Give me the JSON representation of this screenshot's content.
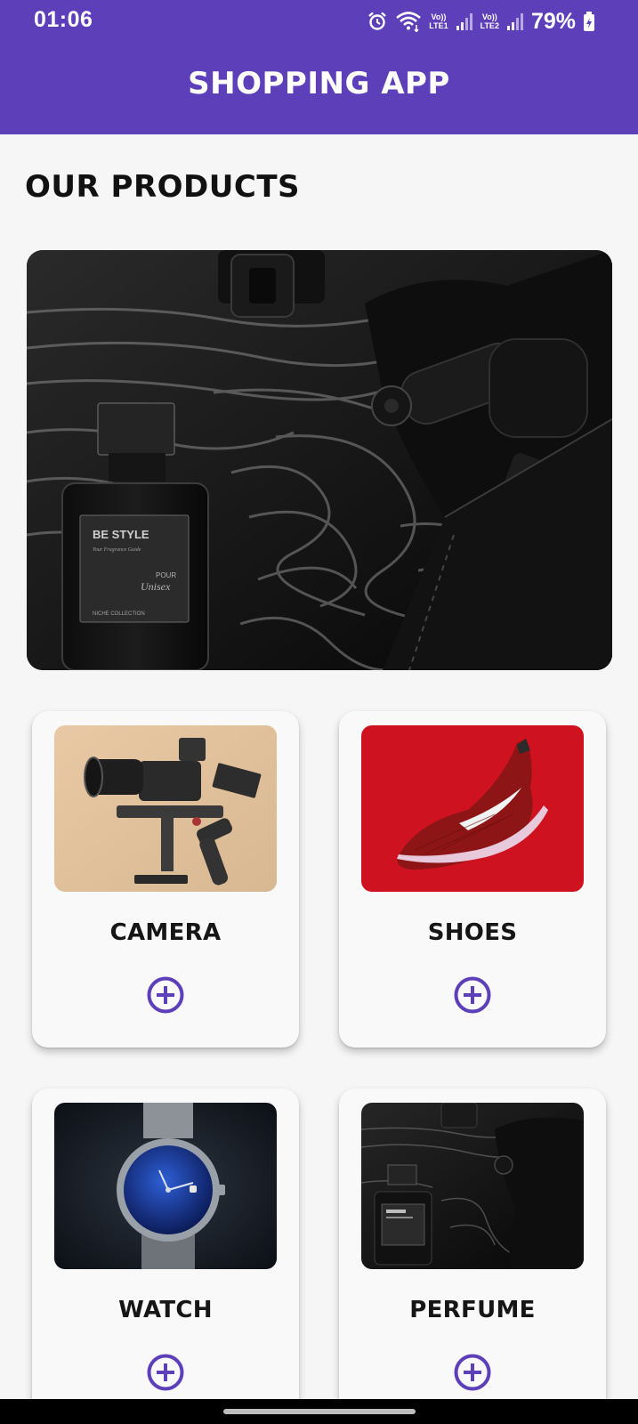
{
  "status_bar": {
    "time": "01:06",
    "sim1_label": "Vo))",
    "sim1_network": "LTE1",
    "sim2_label": "Vo))",
    "sim2_network": "LTE2",
    "battery_percent": "79%",
    "icons": [
      "alarm-icon",
      "wifi-icon",
      "signal-icon",
      "signal-icon",
      "battery-charging-icon"
    ]
  },
  "header": {
    "title": "SHOPPING APP"
  },
  "main": {
    "section_title": "OUR PRODUCTS",
    "hero": {
      "brand": "BE STYLE",
      "tagline": "Your Fragrance Guide",
      "pour": "POUR",
      "type": "Unisex",
      "collection": "NICHE COLLECTION"
    },
    "products": [
      {
        "name": "CAMERA",
        "icon": "add-circle-icon"
      },
      {
        "name": "SHOES",
        "icon": "add-circle-icon"
      },
      {
        "name": "WATCH",
        "icon": "add-circle-icon"
      },
      {
        "name": "PERFUME",
        "icon": "add-circle-icon"
      }
    ]
  },
  "colors": {
    "primary": "#5d3fba",
    "background": "#f6f6f6",
    "card": "#f9f9f9",
    "text": "#111111"
  }
}
